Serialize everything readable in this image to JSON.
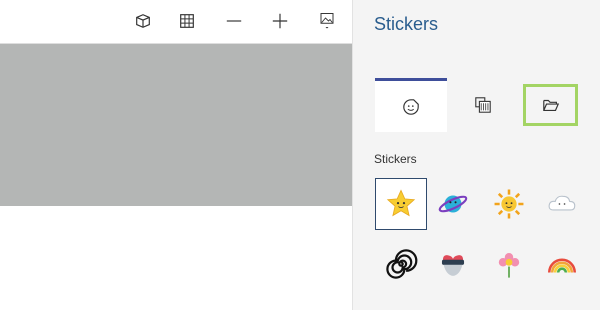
{
  "toolbar": {
    "buttons": [
      {
        "icon": "3d-view-icon"
      },
      {
        "icon": "grid-icon"
      },
      {
        "icon": "zoom-out-icon"
      },
      {
        "icon": "zoom-in-icon"
      },
      {
        "icon": "image-icon"
      }
    ]
  },
  "panel": {
    "title": "Stickers",
    "tabs": [
      {
        "icon": "sticker-smiley-icon",
        "selected": true
      },
      {
        "icon": "texture-icon",
        "selected": false
      },
      {
        "icon": "folder-icon",
        "highlighted": true,
        "highlight_color": "#a3d464"
      }
    ],
    "section_label": "Stickers",
    "stickers": [
      {
        "icon": "star-sticker-icon",
        "selected": true
      },
      {
        "icon": "planet-sticker-icon"
      },
      {
        "icon": "sun-sticker-icon"
      },
      {
        "icon": "cloud-sticker-icon"
      },
      {
        "icon": "spiral-sticker-icon"
      },
      {
        "icon": "heart-glasses-sticker-icon"
      },
      {
        "icon": "flower-sticker-icon"
      },
      {
        "icon": "rainbow-sticker-icon"
      }
    ]
  },
  "colors": {
    "accent": "#3e4e9a",
    "title": "#2a5d8e",
    "canvas": "#b4b6b5",
    "folder_highlight": "#a3d464"
  }
}
